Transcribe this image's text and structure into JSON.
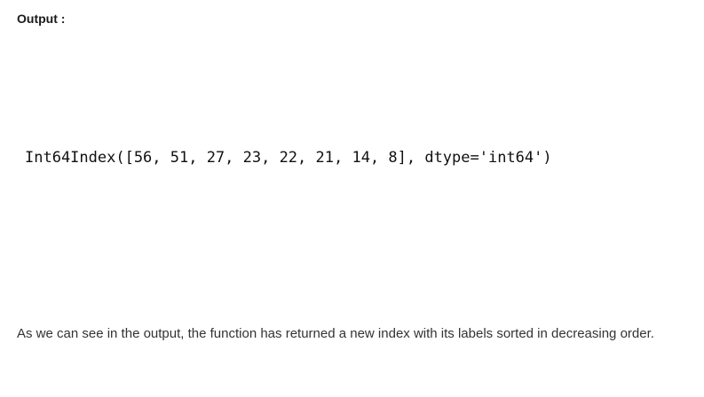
{
  "output_label": "Output :",
  "code_output": "Int64Index([56, 51, 27, 23, 22, 21, 14, 8], dtype='int64')",
  "explanation": "As we can see in the output, the function has returned a new index with its labels sorted in decreasing order."
}
